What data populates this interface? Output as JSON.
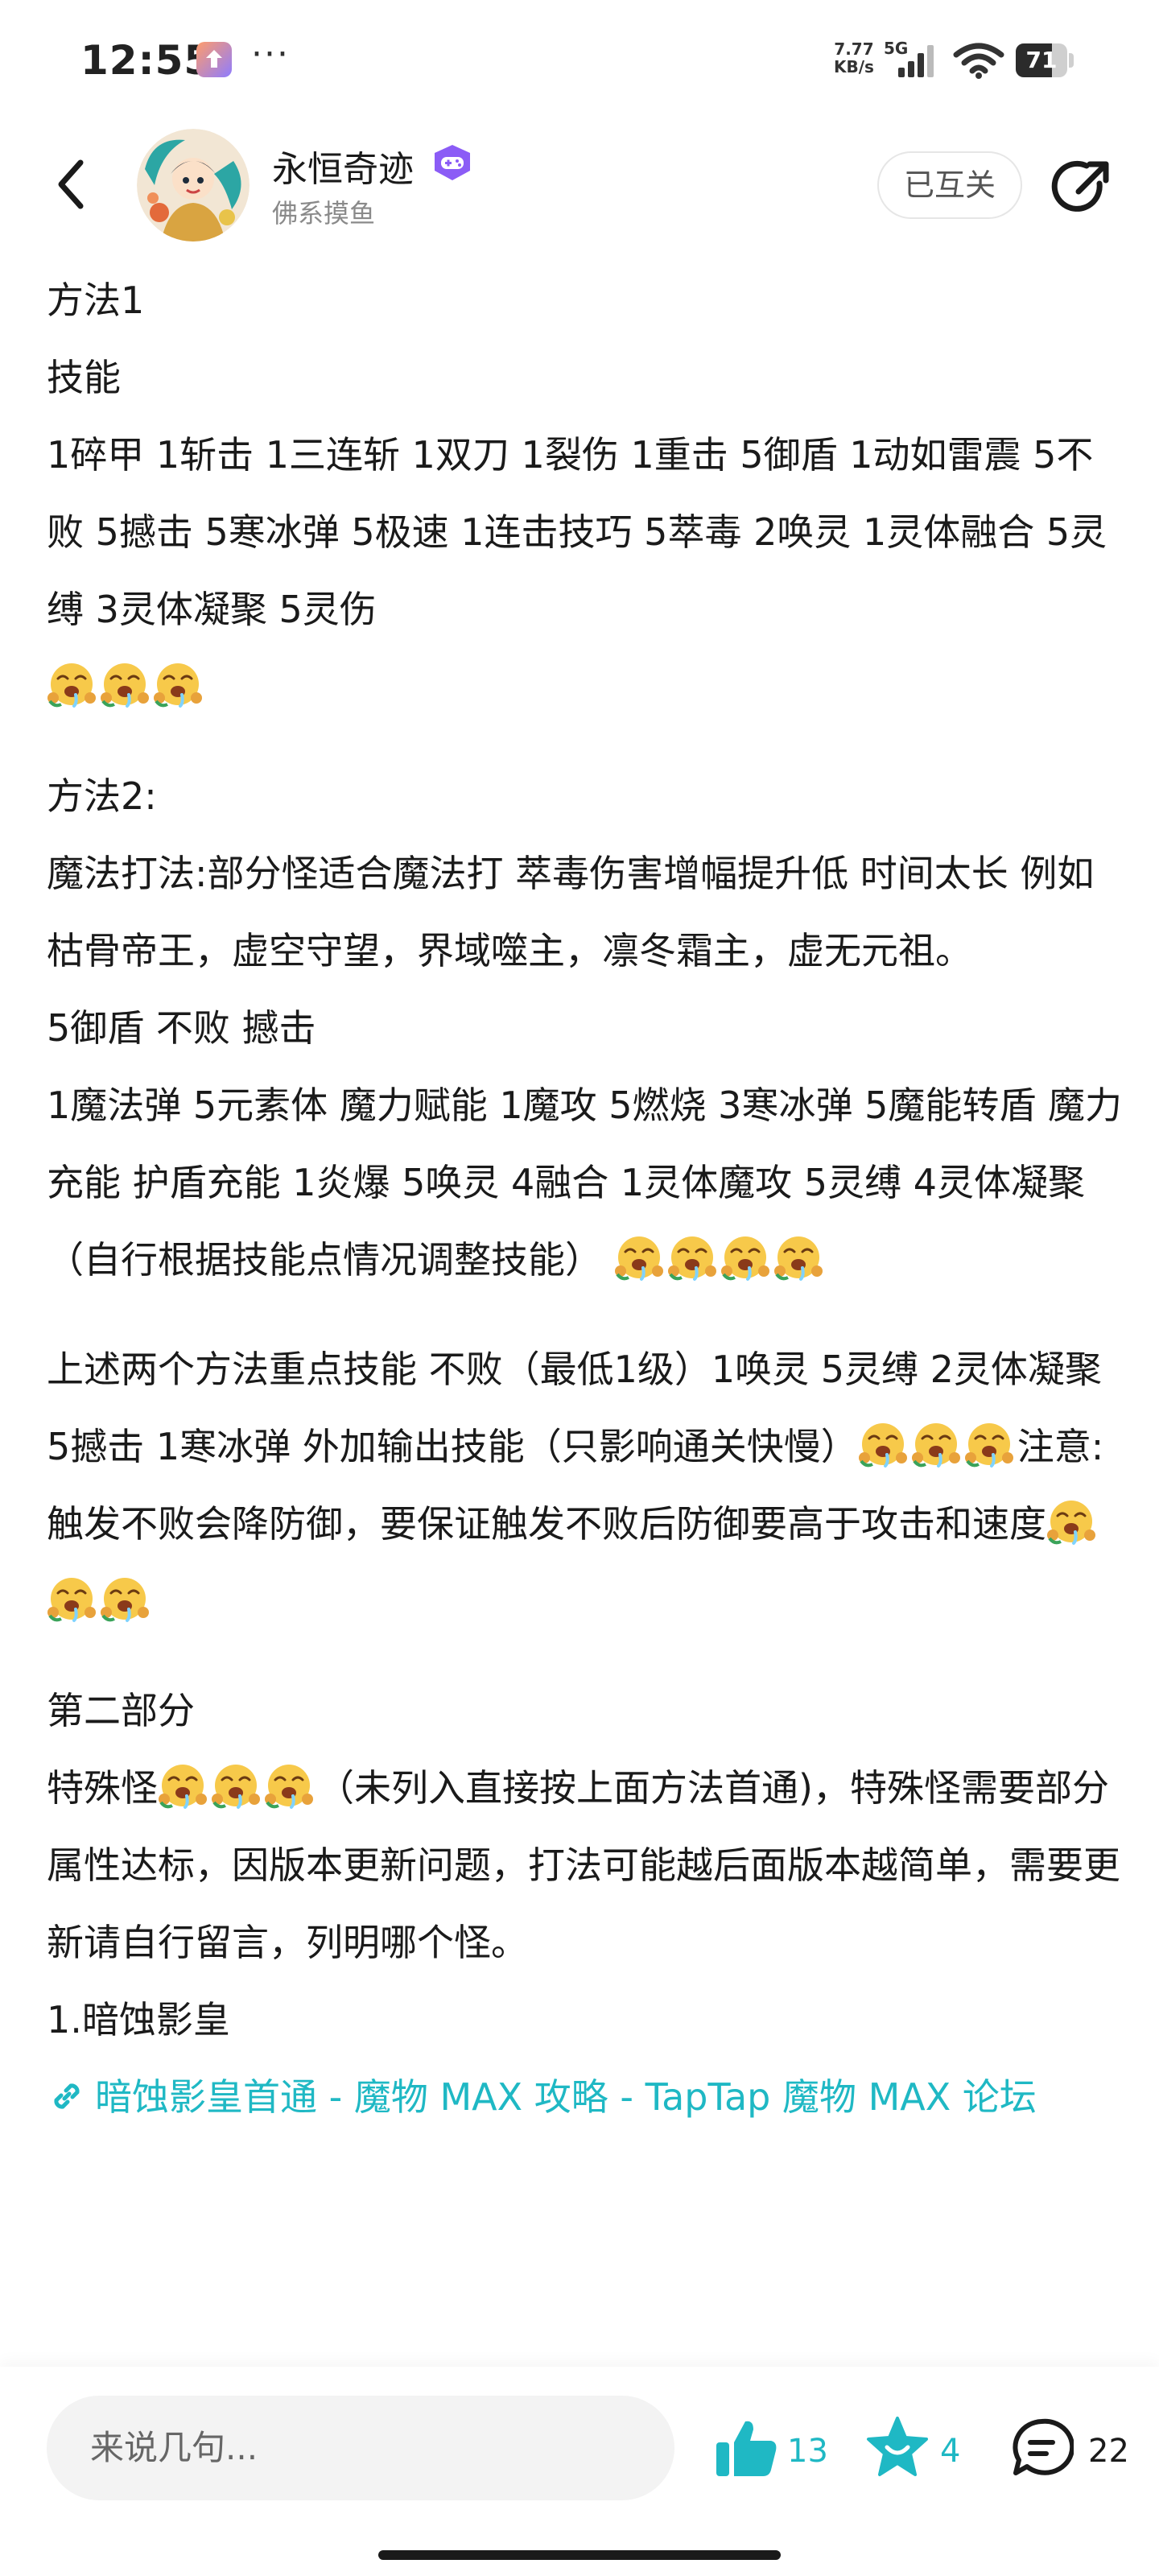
{
  "status": {
    "time": "12:55",
    "dots": "···",
    "net_speed_value": "7.77",
    "net_speed_unit": "KB/s",
    "net_type": "5G",
    "battery": "71",
    "battery_level": 0.71
  },
  "header": {
    "author_name": "永恒奇迹",
    "author_subtitle": "佛系摸鱼",
    "follow_label": "已互关"
  },
  "post": {
    "p1": "方法1",
    "p2": "技能",
    "p3": "1碎甲  1斩击  1三连斩  1双刀 1裂伤 1重击  5御盾  1动如雷震 5不败 5撼击  5寒冰弹 5极速  1连击技巧  5萃毒    2唤灵 1灵体融合 5灵缚  3灵体凝聚 5灵伤",
    "p5": "方法2:",
    "p6": "魔法打法:部分怪适合魔法打 萃毒伤害增幅提升低  时间太长  例如枯骨帝王，虚空守望，界域噬主，凛冬霜主，虚无元祖。",
    "p7": "5御盾   不败   撼击",
    "p8": "1魔法弹  5元素体  魔力赋能  1魔攻  5燃烧  3寒冰弹  5魔能转盾  魔力充能  护盾充能 1炎爆 5唤灵 4融合 1灵体魔攻 5灵缚  4灵体凝聚（自行根据技能点情况调整技能）",
    "p9a": "上述两个方法重点技能  不败（最低1级）1唤灵 5灵缚  2灵体凝聚  5撼击  1寒冰弹   外加输出技能（只影响通关快慢）",
    "p9b": "注意:触发不败会降防御，要保证触发不败后防御要高于攻击和速度",
    "p10": "第二部分",
    "p11a": "特殊怪",
    "p11b": "（未列入直接按上面方法首通)，特殊怪需要部分属性达标，因版本更新问题，打法可能越后面版本越简单，需要更新请自行留言，列明哪个怪。",
    "p12": "1.暗蚀影皇",
    "link_text": "暗蚀影皇首通 - 魔物 MAX 攻略 - TapTap 魔物 MAX 论坛"
  },
  "bottom": {
    "comment_placeholder": "来说几句...",
    "like_count": "13",
    "fav_count": "4",
    "comment_count": "22"
  },
  "colors": {
    "accent": "#1fb8c4",
    "badge": "#8b5cf6"
  },
  "icons": {
    "back": "chevron-left-icon",
    "share": "share-icon",
    "emoji": "drool-face-emoji-icon",
    "link": "link-icon",
    "like": "thumbs-up-icon",
    "favorite": "star-icon",
    "comment": "comment-bubble-icon"
  }
}
